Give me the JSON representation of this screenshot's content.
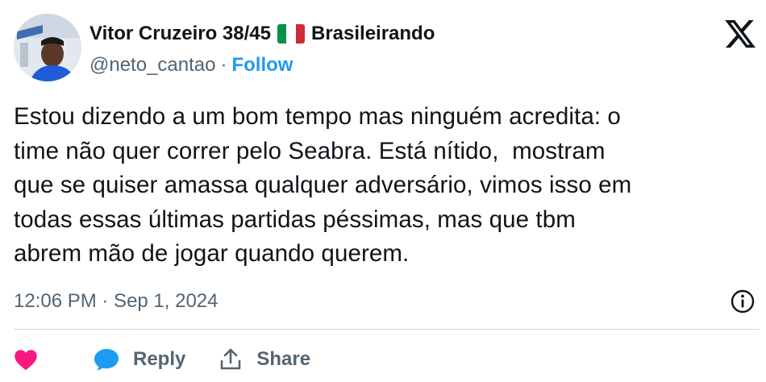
{
  "user": {
    "display_name": "Vitor Cruzeiro 38/45",
    "flag": "italy-flag",
    "community": "Brasileirando",
    "handle": "@neto_cantao",
    "separator": "·",
    "follow_label": "Follow"
  },
  "tweet": {
    "text": "Estou dizendo a um bom tempo mas ninguém acredita: o\ntime não quer correr pelo Seabra. Está nítido,  mostram\nque se quiser amassa qualquer adversário, vimos isso em\ntodas essas últimas partidas péssimas, mas que tbm\nabrem mão de jogar quando querem.",
    "timestamp": "12:06 PM · Sep 1, 2024"
  },
  "actions": {
    "like_icon": "heart-icon",
    "reply_label": "Reply",
    "share_label": "Share"
  },
  "icons": {
    "platform_logo": "x-logo-icon",
    "info": "info-icon"
  },
  "colors": {
    "follow": "#1d9bf0",
    "like": "#f91880",
    "reply": "#1d9bf0",
    "secondary_text": "#536471"
  }
}
